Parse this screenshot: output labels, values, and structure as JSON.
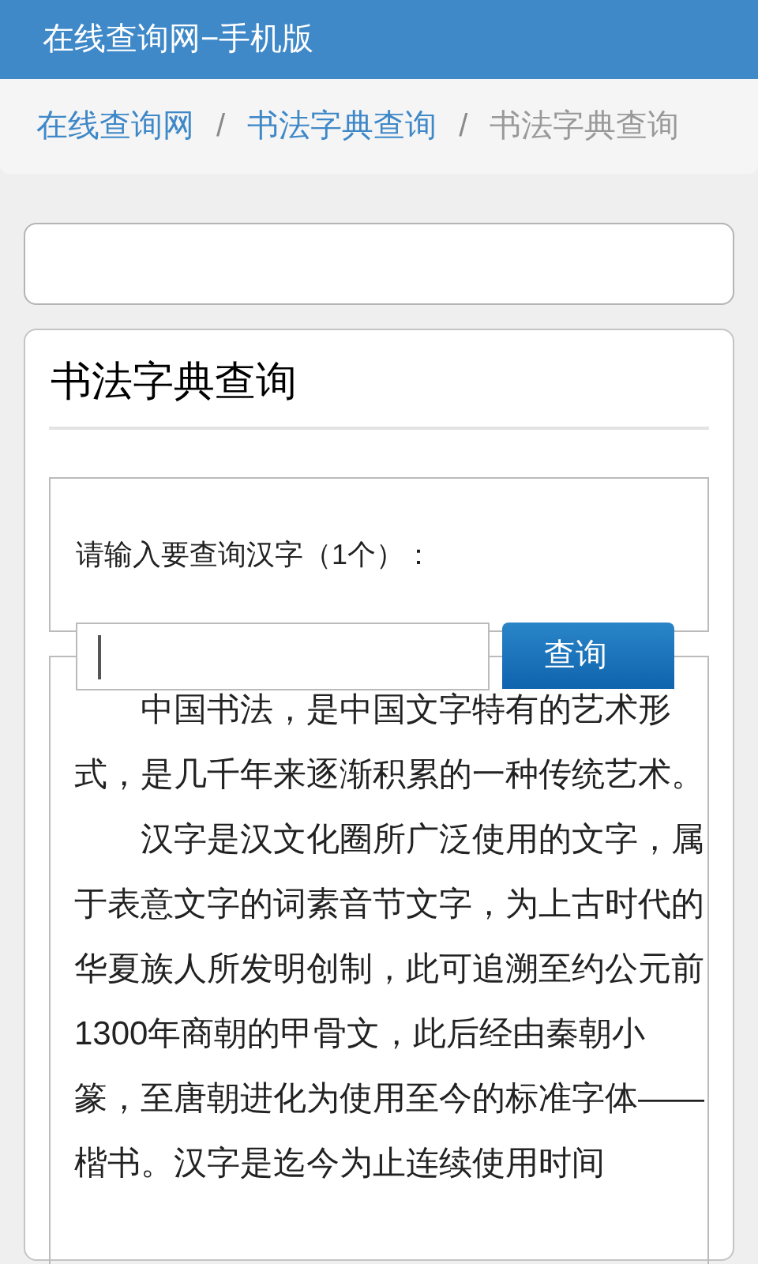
{
  "header": {
    "title": "在线查询网−手机版"
  },
  "breadcrumb": [
    {
      "kind": "link",
      "text": "在线查询网"
    },
    {
      "kind": "separator",
      "text": "/"
    },
    {
      "kind": "link",
      "text": "书法字典查询"
    },
    {
      "kind": "separator",
      "text": "/"
    },
    {
      "kind": "current",
      "text": "书法字典查询"
    }
  ],
  "panel": {
    "title": "书法字典查询",
    "prompt": "请输入要查询汉字（1个）：",
    "query_button": "查询",
    "paragraphs": [
      "中国书法，是中国文字特有的艺术形式，是几千年来逐渐积累的一种传统艺术。",
      "汉字是汉文化圈所广泛使用的文字，属于表意文字的词素音节文字，为上古时代的华夏族人所发明创制，此可追溯至约公元前1300年商朝的甲骨文，此后经由秦朝小篆，至唐朝进化为使用至今的标准字体——楷书。汉字是迄今为止连续使用时间"
    ]
  }
}
